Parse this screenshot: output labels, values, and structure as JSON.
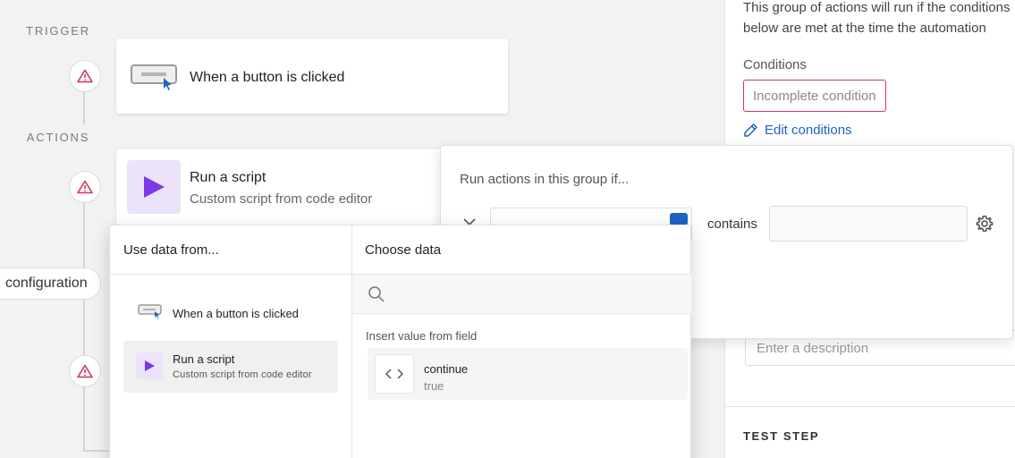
{
  "canvas": {
    "trigger_label": "TRIGGER",
    "actions_label": "ACTIONS",
    "trigger_card": {
      "title": "When a button is clicked"
    },
    "script_card": {
      "title": "Run a script",
      "subtitle": "Custom script from code editor"
    },
    "configuration_label": "configuration"
  },
  "side_panel": {
    "description": "This group of actions will run if the conditions\nbelow are met at the time the automation",
    "conditions_label": "Conditions",
    "incomplete_badge": "Incomplete condition",
    "edit_conditions_link": "Edit conditions",
    "description_placeholder": "Enter a description",
    "test_step_heading": "TEST STEP"
  },
  "condition_popup": {
    "title": "Run actions in this group if...",
    "operator": "contains"
  },
  "data_picker": {
    "left_header": "Use data from...",
    "right_header": "Choose data",
    "sources": [
      {
        "title": "When a button is clicked",
        "subtitle": ""
      },
      {
        "title": "Run a script",
        "subtitle": "Custom script from code editor"
      }
    ],
    "search_placeholder": "",
    "insert_label": "Insert value from field",
    "fields": [
      {
        "name": "continue",
        "value": "true"
      }
    ]
  },
  "colors": {
    "accent_blue": "#1f62c4",
    "warning_red": "#d0355a",
    "script_purple": "#7c3ae6",
    "script_tile_bg": "#ece3fb"
  },
  "icons": {
    "warning": "warning-triangle-icon",
    "button": "button-cursor-icon",
    "script": "play-icon",
    "pencil": "pencil-icon",
    "gear": "gear-icon",
    "search": "search-icon",
    "code": "code-brackets-icon",
    "chevron": "chevron-down-icon"
  }
}
